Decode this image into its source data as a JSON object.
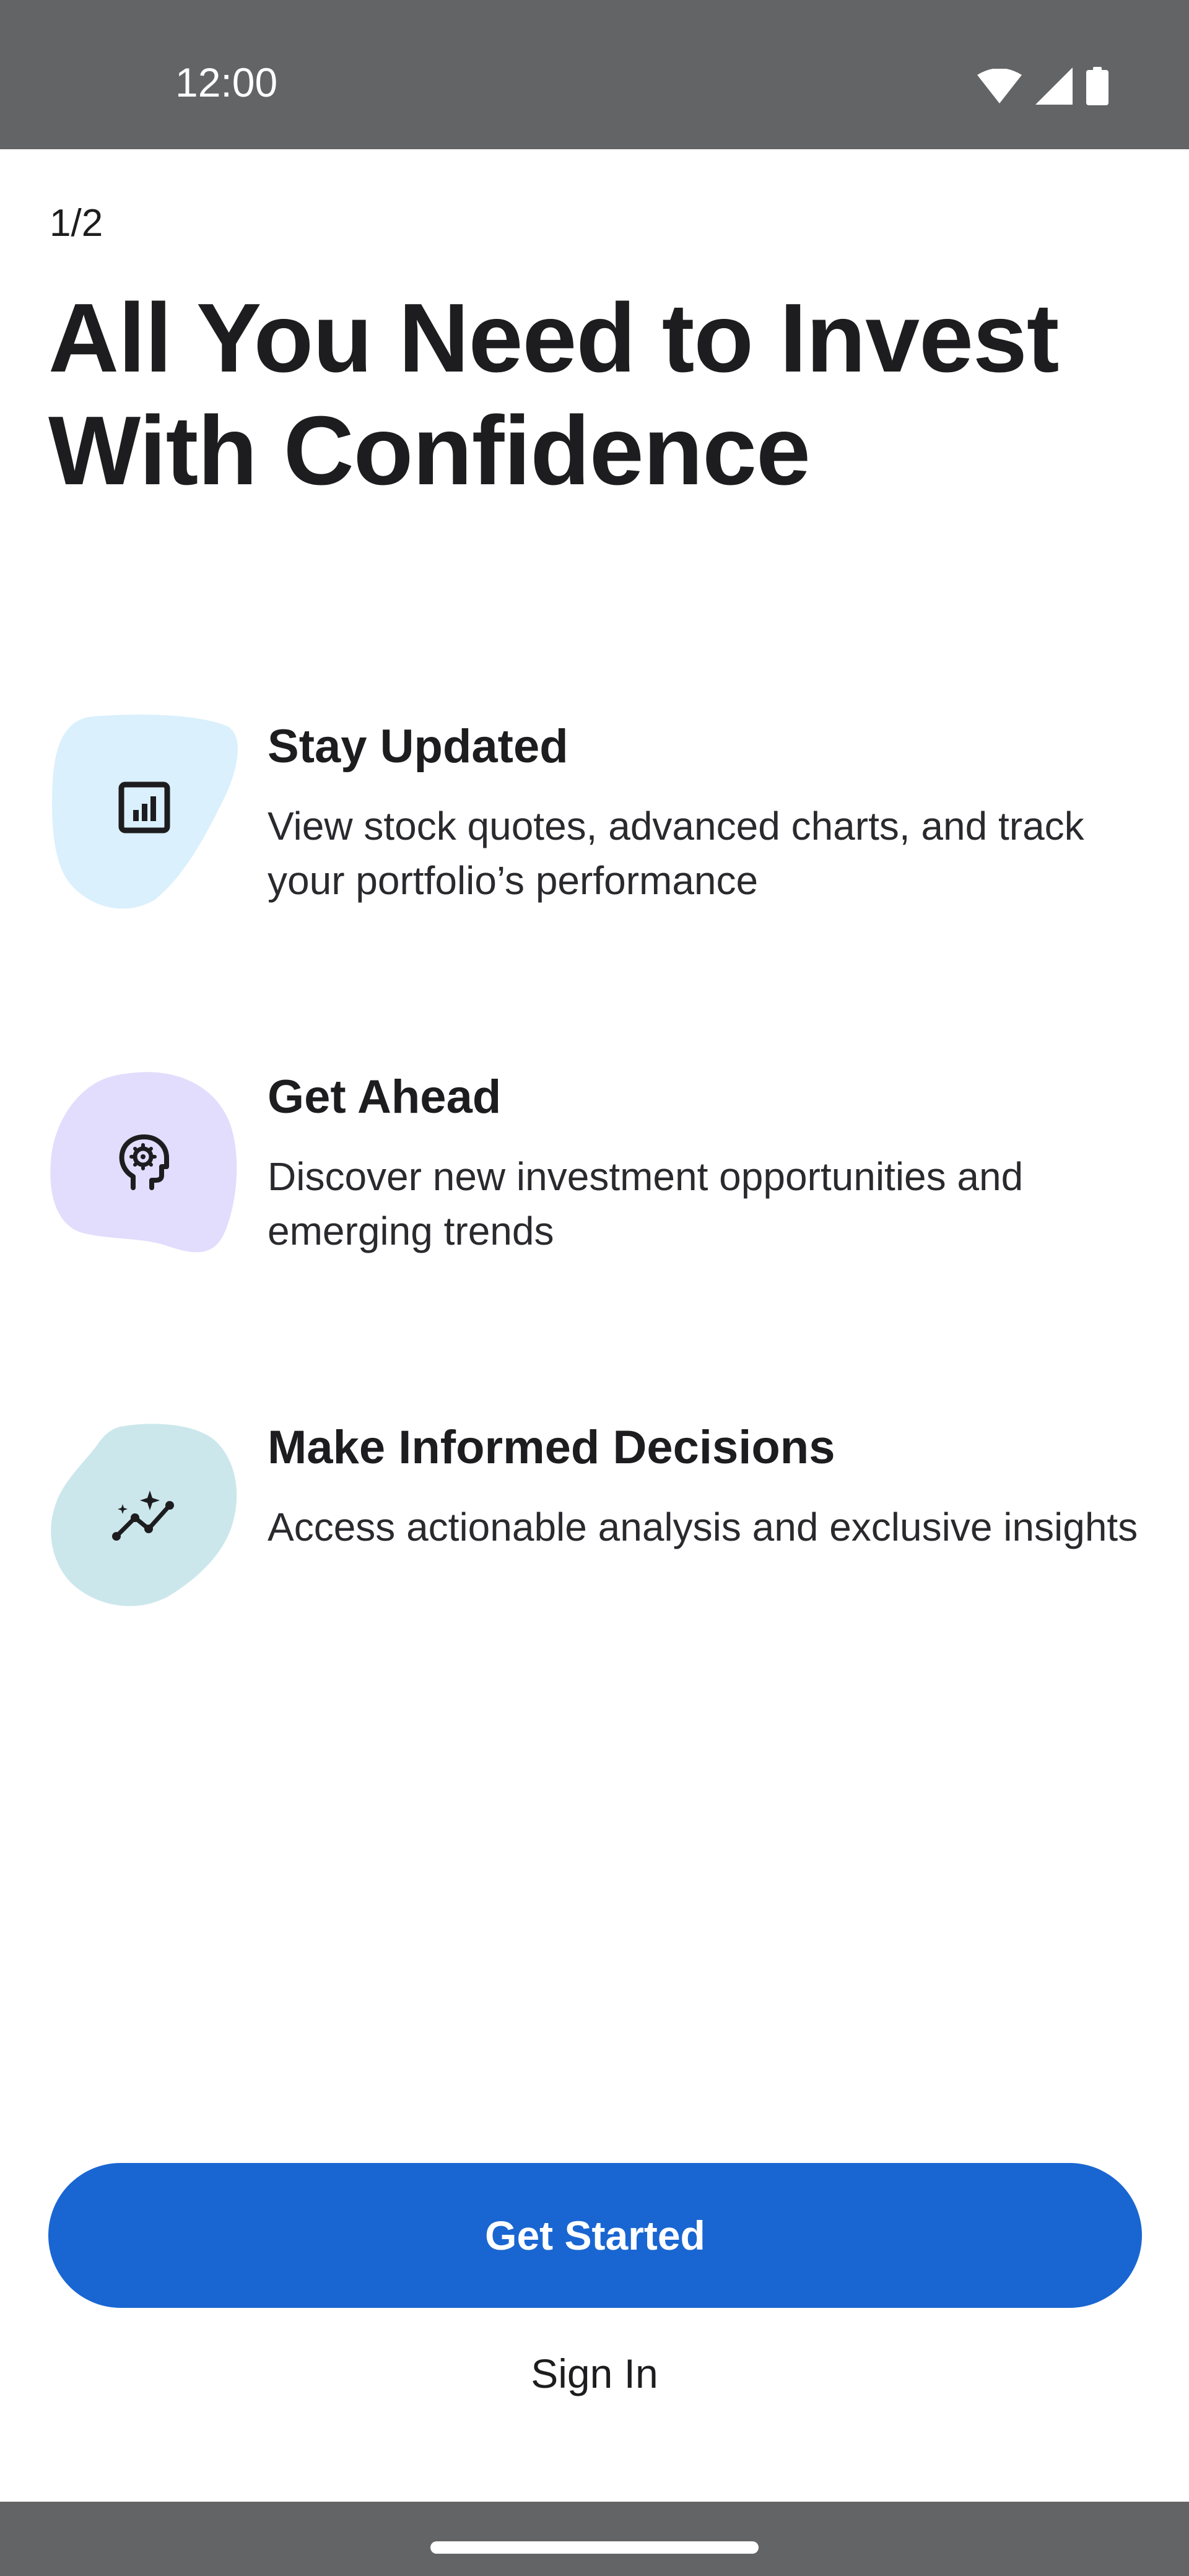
{
  "status_bar": {
    "time": "12:00",
    "icons": [
      "wifi-icon",
      "signal-icon",
      "battery-icon"
    ],
    "background_color": "#636466"
  },
  "onboarding": {
    "page_counter": "1/2",
    "headline": "All You Need to Invest With Confidence",
    "features": [
      {
        "icon": "bar-chart-icon",
        "blob_color": "#daf0fc",
        "title": "Stay Updated",
        "description": "View stock quotes, advanced charts, and track your portfolio’s performance"
      },
      {
        "icon": "head-gear-icon",
        "blob_color": "#e2dcfd",
        "title": "Get Ahead",
        "description": "Discover new investment opportunities and emerging trends"
      },
      {
        "icon": "sparkle-trend-icon",
        "blob_color": "#cbe7ec",
        "title": "Make Informed Decisions",
        "description": "Access actionable analysis and exclusive insights"
      }
    ]
  },
  "actions": {
    "primary_label": "Get Started",
    "primary_color": "#1966d2",
    "secondary_label": "Sign In"
  }
}
